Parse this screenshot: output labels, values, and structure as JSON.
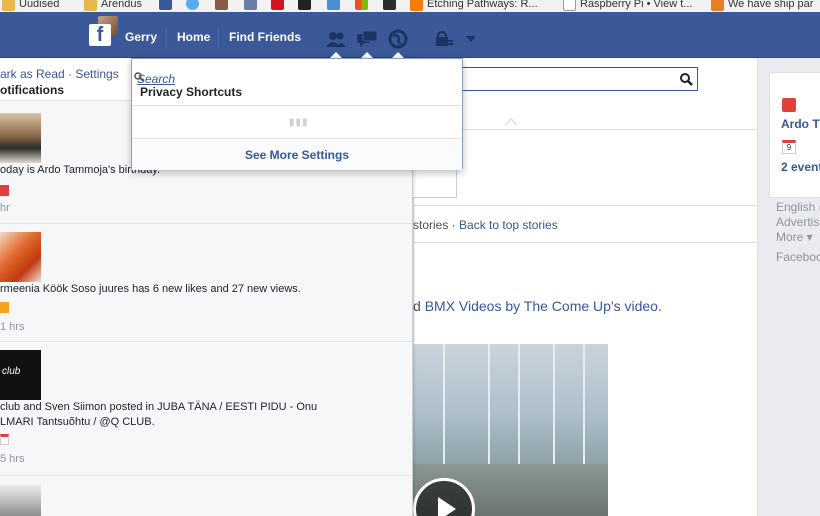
{
  "bookmarks": [
    {
      "label": "Uudised",
      "icon": "folder-icon",
      "color": "#e8b94a"
    },
    {
      "label": "Arendus",
      "icon": "folder-icon",
      "color": "#e8b94a"
    },
    {
      "label": "",
      "icon": "facebook-icon",
      "color": "#3b5998"
    },
    {
      "label": "",
      "icon": "twitter-icon",
      "color": "#55acee"
    },
    {
      "label": "",
      "icon": "instagram-icon",
      "color": "#8a5a44"
    },
    {
      "label": "",
      "icon": "n-icon",
      "color": "#6a7fa8"
    },
    {
      "label": "",
      "icon": "youtube-icon",
      "color": "#cc181e"
    },
    {
      "label": "",
      "icon": "s-icon",
      "color": "#222222"
    },
    {
      "label": "",
      "icon": "photo-icon",
      "color": "#4a8cd6"
    },
    {
      "label": "",
      "icon": "windows-icon",
      "color": "#1ba1e2"
    },
    {
      "label": "",
      "icon": "bl-icon",
      "color": "#2b2b2b"
    },
    {
      "label": "Etching Pathways: R...",
      "icon": "blogger-icon",
      "color": "#f57d00"
    },
    {
      "label": "Raspberry Pi • View t...",
      "icon": "page-icon",
      "color": "#ffffff"
    },
    {
      "label": "We have ship par",
      "icon": "cart-icon",
      "color": "#e67e22"
    }
  ],
  "topbar": {
    "user_name": "Gerry",
    "home": "Home",
    "find_friends": "Find Friends",
    "logo_letter": "f"
  },
  "search": {
    "placeholder": "S"
  },
  "notifications": {
    "mark_read": "ark as Read",
    "settings": "Settings",
    "title": "otifications",
    "items": [
      {
        "text": "oday is Ardo Tammoja's birthday.",
        "time": "hr",
        "icon": "gift-icon"
      },
      {
        "text": "rmeenia Köök Soso juures has 6 new likes and 27 new views.",
        "time": "1 hrs",
        "icon": "flag-icon"
      },
      {
        "text_line1": "club and Sven Siimon posted in JUBA TÄNA / EESTI PIDU - Onu",
        "text_line2": "LMARI Tantsuõhtu / @Q CLUB.",
        "time": "5 hrs",
        "icon": "calendar-icon",
        "thumb_text": "club"
      }
    ]
  },
  "privacy": {
    "search_label": "Search",
    "title": "Privacy Shortcuts",
    "see_more": "See More Settings"
  },
  "feed": {
    "stories_prefix": "stories",
    "back_to_top": "Back to top stories",
    "story_prefix": "d ",
    "story_page": "BMX Videos by The Come Up",
    "story_suffix": "'s ",
    "story_video": "video",
    "story_end": "."
  },
  "right": {
    "birthday_name": "Ardo T",
    "events": "2 event",
    "calendar_day": "9",
    "footer": [
      "English (",
      "Advertis",
      "More ▾",
      "Faceboo"
    ]
  }
}
